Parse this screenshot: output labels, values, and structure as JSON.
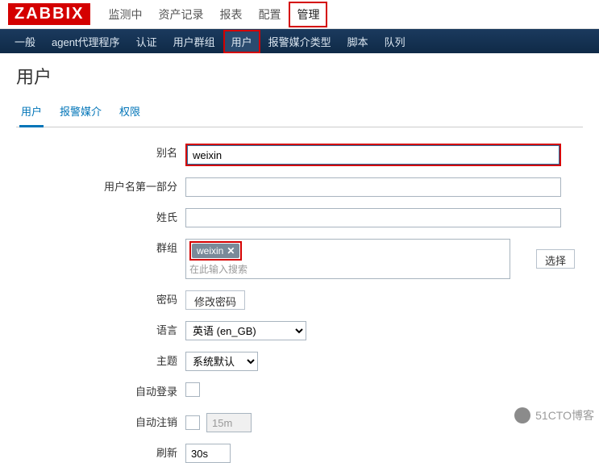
{
  "logo": "ZABBIX",
  "topnav": {
    "items": [
      "监测中",
      "资产记录",
      "报表",
      "配置",
      "管理"
    ],
    "active": 4
  },
  "subnav": {
    "items": [
      "一般",
      "agent代理程序",
      "认证",
      "用户群组",
      "用户",
      "报警媒介类型",
      "脚本",
      "队列"
    ],
    "active": 4
  },
  "page_title": "用户",
  "tabs": {
    "items": [
      "用户",
      "报警媒介",
      "权限"
    ],
    "active": 0
  },
  "form": {
    "alias": {
      "label": "别名",
      "value": "weixin"
    },
    "name_first": {
      "label": "用户名第一部分",
      "value": ""
    },
    "surname": {
      "label": "姓氏",
      "value": ""
    },
    "groups": {
      "label": "群组",
      "tags": [
        "weixin"
      ],
      "placeholder": "在此输入搜索",
      "select_btn": "选择"
    },
    "password": {
      "label": "密码",
      "button": "修改密码"
    },
    "language": {
      "label": "语言",
      "value": "英语 (en_GB)",
      "options": [
        "英语 (en_GB)"
      ]
    },
    "theme": {
      "label": "主题",
      "value": "系统默认",
      "options": [
        "系统默认"
      ]
    },
    "autologin": {
      "label": "自动登录",
      "checked": false
    },
    "autologout": {
      "label": "自动注销",
      "checked": false,
      "value": "15m"
    },
    "refresh": {
      "label": "刷新",
      "value": "30s"
    }
  },
  "watermark": "51CTO博客"
}
